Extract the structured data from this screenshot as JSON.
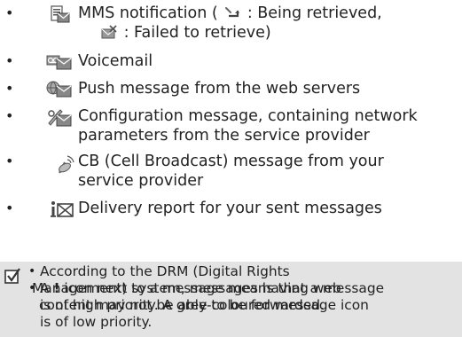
{
  "items": [
    {
      "icon": "mms-notification-icon",
      "lines": [
        "MMS notification (",
        ": Being retrieved,",
        ": Failed to retrieve)"
      ]
    },
    {
      "icon": "voicemail-icon",
      "lines": [
        "Voicemail"
      ]
    },
    {
      "icon": "push-message-icon",
      "lines": [
        "Push message from the web servers"
      ]
    },
    {
      "icon": "configuration-message-icon",
      "lines": [
        "Configuration message, containing network",
        "parameters from the service provider"
      ]
    },
    {
      "icon": "cell-broadcast-icon",
      "lines": [
        "CB (Cell Broadcast) message from your",
        "service provider"
      ]
    },
    {
      "icon": "delivery-report-icon",
      "lines": [
        "Delivery report for your sent messages"
      ]
    }
  ],
  "note": {
    "icon": "checkmark-note-icon",
    "bullets": [
      {
        "lines": [
          "According to the DRM (Digital Rights",
          "Management) system, messages having web",
          "content may not be able to be forwarded."
        ]
      },
      {
        "lines": [
          "A",
          "!",
          "icon next to a message means that a message",
          "is of high priority. A grey-coloured message icon",
          "is of low priority."
        ]
      }
    ]
  }
}
